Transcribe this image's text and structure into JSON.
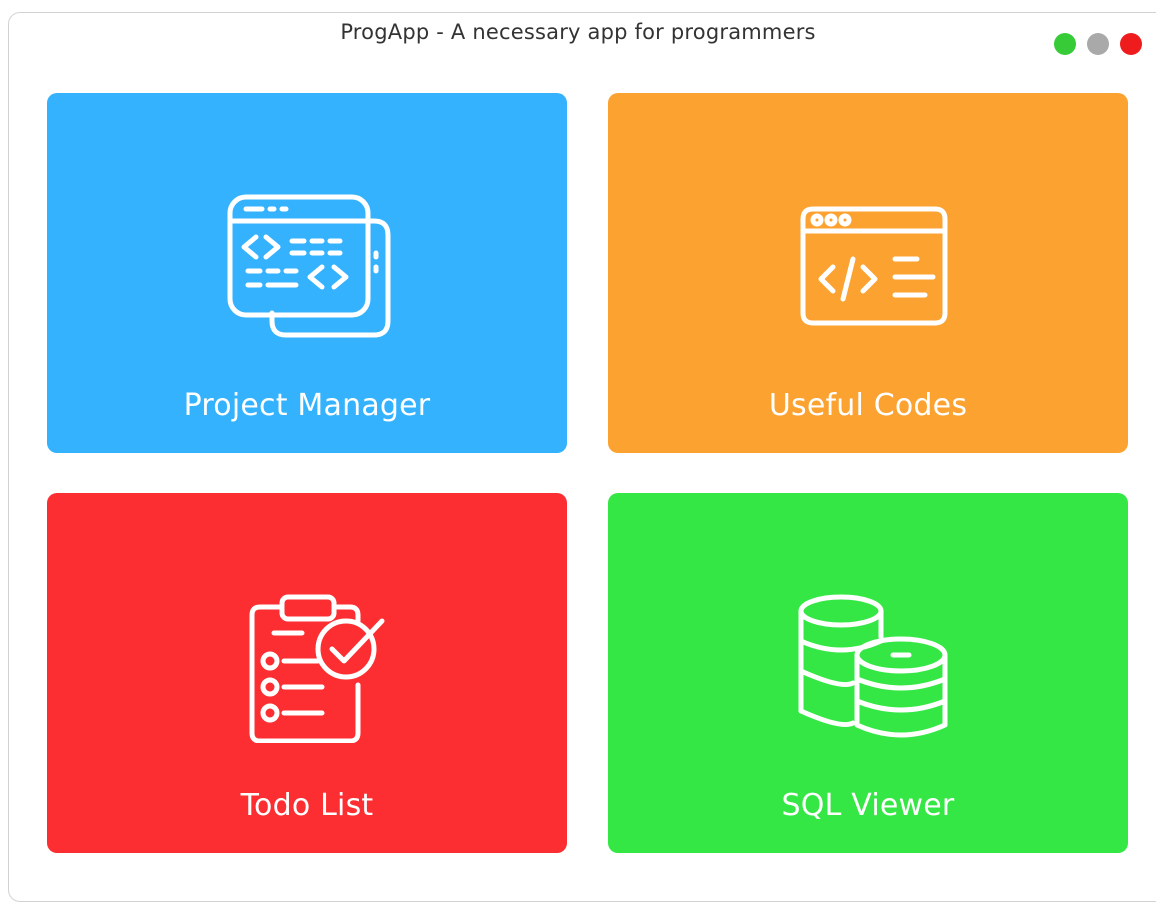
{
  "window": {
    "title": "ProgApp - A necessary app for programmers",
    "controls": [
      {
        "name": "maximize",
        "color": "#37cc37"
      },
      {
        "name": "minimize",
        "color": "#a9a9a9"
      },
      {
        "name": "close",
        "color": "#ee1c1c"
      }
    ]
  },
  "tiles": [
    {
      "label": "Project Manager",
      "color": "#34b2fe",
      "icon": "code-window-icon"
    },
    {
      "label": "Useful Codes",
      "color": "#fca231",
      "icon": "code-browser-icon"
    },
    {
      "label": "Todo List",
      "color": "#fd2e31",
      "icon": "clipboard-check-icon"
    },
    {
      "label": "SQL Viewer",
      "color": "#35e745",
      "icon": "database-icon"
    }
  ]
}
